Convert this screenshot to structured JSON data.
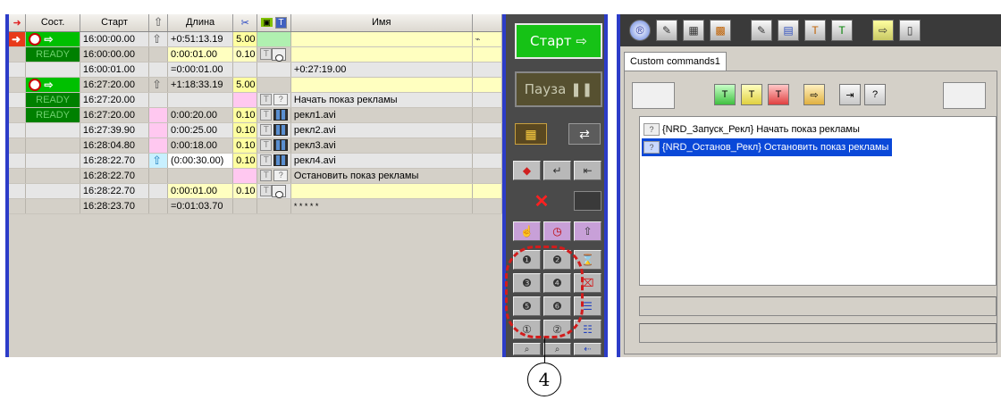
{
  "playlist": {
    "headers": [
      "Сост.",
      "Старт",
      "Длина",
      "Имя"
    ],
    "rows": [
      {
        "start": "16:00:00.00",
        "length": "+0:51:13.19",
        "rate": "5.00",
        "name": ""
      },
      {
        "state": "READY",
        "start": "16:00:00.00",
        "length": "0:00:01.00",
        "rate": "0.10",
        "name": ""
      },
      {
        "start": "16:00:01.00",
        "length": "=0:00:01.00",
        "rate": "",
        "name": "+0:27:19.00"
      },
      {
        "start": "16:27:20.00",
        "length": "+1:18:33.19",
        "rate": "5.00",
        "name": ""
      },
      {
        "state": "READY",
        "start": "16:27:20.00",
        "length": "",
        "rate": "",
        "name": "Начать показ рекламы"
      },
      {
        "state": "READY",
        "start": "16:27:20.00",
        "length": "0:00:20.00",
        "rate": "0.10",
        "name": "рекл1.avi"
      },
      {
        "start": "16:27:39.90",
        "length": "0:00:25.00",
        "rate": "0.10",
        "name": "рекл2.avi"
      },
      {
        "start": "16:28:04.80",
        "length": "0:00:18.00",
        "rate": "0.10",
        "name": "рекл3.avi"
      },
      {
        "start": "16:28:22.70",
        "length": "(0:00:30.00)",
        "rate": "0.10",
        "name": "рекл4.avi"
      },
      {
        "start": "16:28:22.70",
        "length": "",
        "rate": "",
        "name": "Остановить показ  рекламы"
      },
      {
        "start": "16:28:22.70",
        "length": "0:00:01.00",
        "rate": "0.10",
        "name": ""
      },
      {
        "start": "16:28:23.70",
        "length": "=0:01:03.70",
        "rate": "",
        "name": "* * * * *"
      }
    ]
  },
  "controls": {
    "start_label": "Старт ⇨",
    "pause_label": "Пауза ❚❚"
  },
  "right": {
    "tab_label": "Custom commands1",
    "commands": [
      {
        "text": "{NRD_Запуск_Рекл} Начать показ рекламы"
      },
      {
        "text": "{NRD_Останов_Рекл} Остановить показ  рекламы"
      }
    ]
  },
  "annotation": {
    "callout_number": "4"
  },
  "colors": {
    "accent_blue": "#2c3cc8",
    "start_green": "#16c216",
    "ready_green": "#008000",
    "selection": "#0a48d8",
    "annotation_red": "#d21c1c"
  }
}
